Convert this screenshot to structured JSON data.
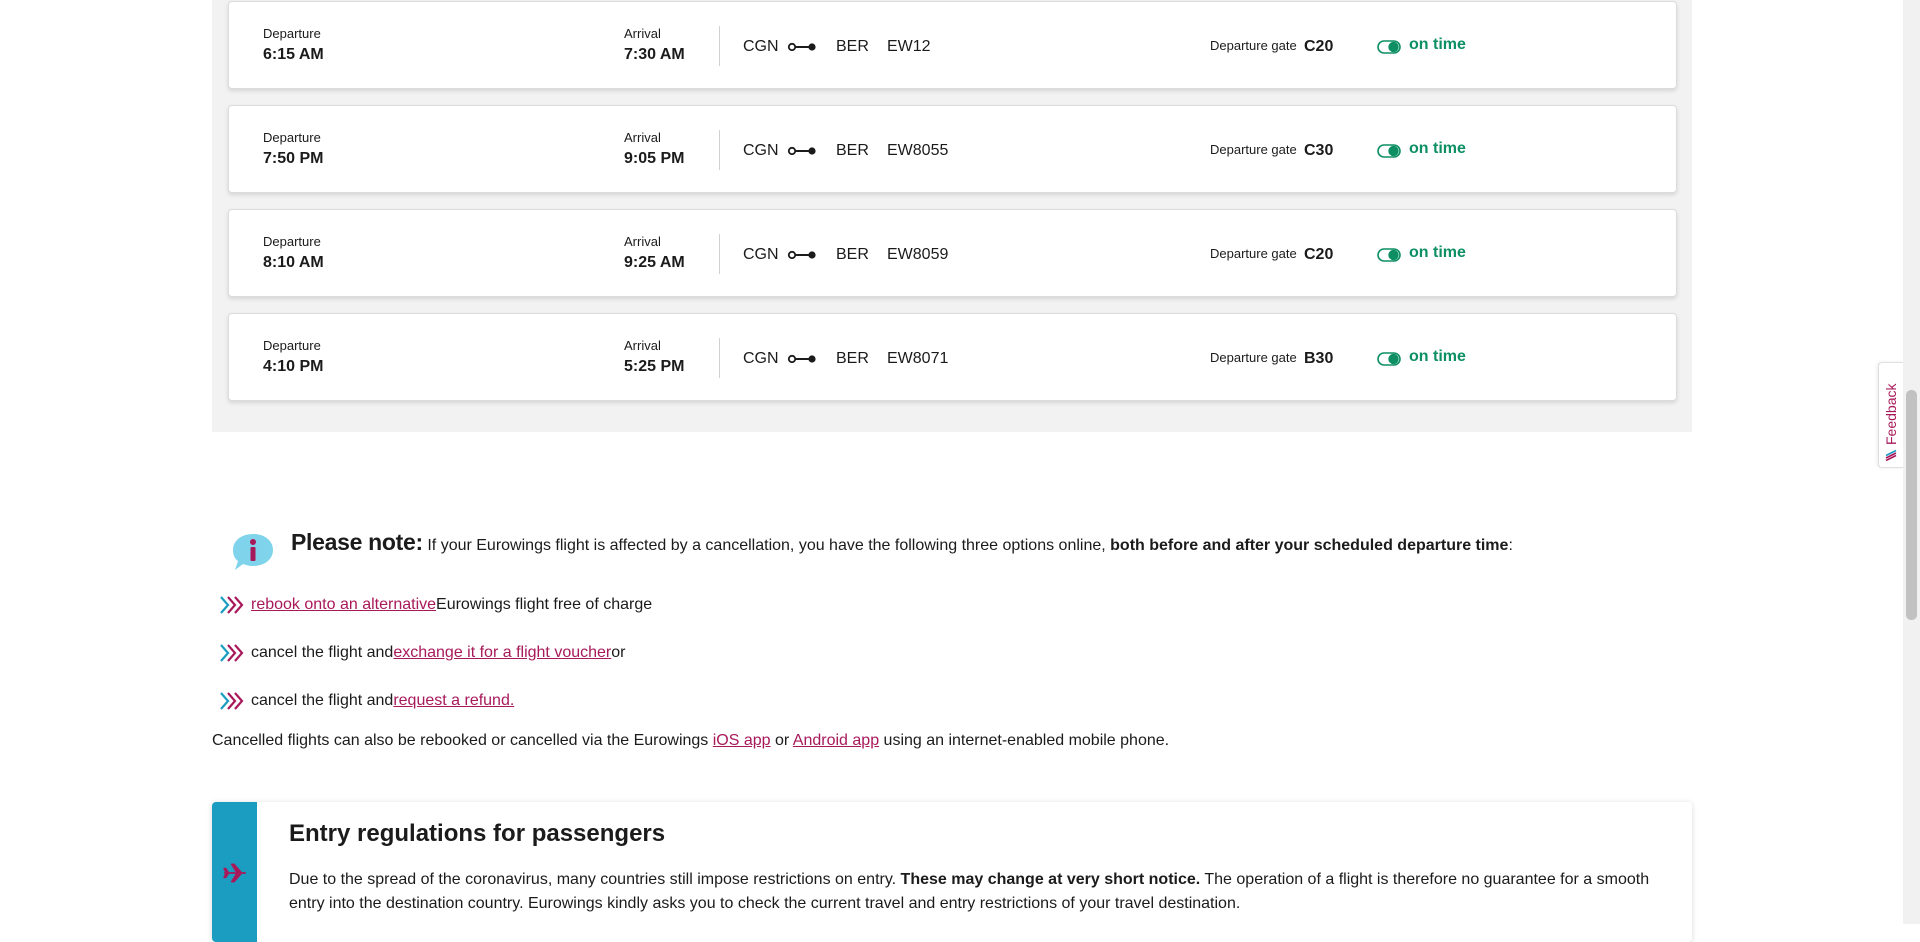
{
  "flights": [
    {
      "departure_label": "Departure",
      "departure_time": "6:15 AM",
      "arrival_label": "Arrival",
      "arrival_time": "7:30 AM",
      "from": "CGN",
      "to": "BER",
      "flight_number": "EW12",
      "gate_label": "Departure gate",
      "gate": "C20",
      "status": "on time"
    },
    {
      "departure_label": "Departure",
      "departure_time": "7:50 PM",
      "arrival_label": "Arrival",
      "arrival_time": "9:05 PM",
      "from": "CGN",
      "to": "BER",
      "flight_number": "EW8055",
      "gate_label": "Departure gate",
      "gate": "C30",
      "status": "on time"
    },
    {
      "departure_label": "Departure",
      "departure_time": "8:10 AM",
      "arrival_label": "Arrival",
      "arrival_time": "9:25 AM",
      "from": "CGN",
      "to": "BER",
      "flight_number": "EW8059",
      "gate_label": "Departure gate",
      "gate": "C20",
      "status": "on time"
    },
    {
      "departure_label": "Departure",
      "departure_time": "4:10 PM",
      "arrival_label": "Arrival",
      "arrival_time": "5:25 PM",
      "from": "CGN",
      "to": "BER",
      "flight_number": "EW8071",
      "gate_label": "Departure gate",
      "gate": "B30",
      "status": "on time"
    }
  ],
  "note": {
    "heading": "Please note:",
    "text": " If your Eurowings flight is affected by a cancellation, you have the following three options online, ",
    "bold_text": "both before and after your scheduled departure time",
    "text_end": ":",
    "options": [
      {
        "prefix": "",
        "link": "rebook onto an alternative",
        "suffix": " Eurowings flight free of charge"
      },
      {
        "prefix": "cancel the flight and ",
        "link": "exchange it for a flight voucher",
        "suffix": " or"
      },
      {
        "prefix": "cancel the flight and ",
        "link": "request a refund.",
        "suffix": ""
      }
    ]
  },
  "cancelled_info": {
    "text_before": "Cancelled flights can also be rebooked or cancelled via the Eurowings ",
    "ios_link": "iOS app",
    "text_or": " or ",
    "android_link": "Android app",
    "text_after": " using an internet-enabled mobile phone."
  },
  "entry_regulations": {
    "title": "Entry regulations for passengers",
    "text_1": "Due to the spread of the coronavirus, many countries still impose restrictions on entry. ",
    "text_bold": "These may change at very short notice.",
    "text_2": " The operation of a flight is therefore no guarantee for a smooth entry into the destination country. Eurowings kindly asks you to check the current travel and entry restrictions of your travel destination."
  },
  "feedback": {
    "label": "Feedback"
  },
  "colors": {
    "status_green": "#0d8f63",
    "link_magenta": "#a8195a",
    "entry_bar_blue": "#1b9dc2",
    "note_icon_blue": "#7fd3ea"
  },
  "icons": {
    "route": "route-dots-icon",
    "status": "status-toggle-icon",
    "note": "info-speech-bubble-icon",
    "bullet": "triple-chevron-icon",
    "entry": "airplane-icon",
    "feedback": "eurowings-logo-icon"
  }
}
